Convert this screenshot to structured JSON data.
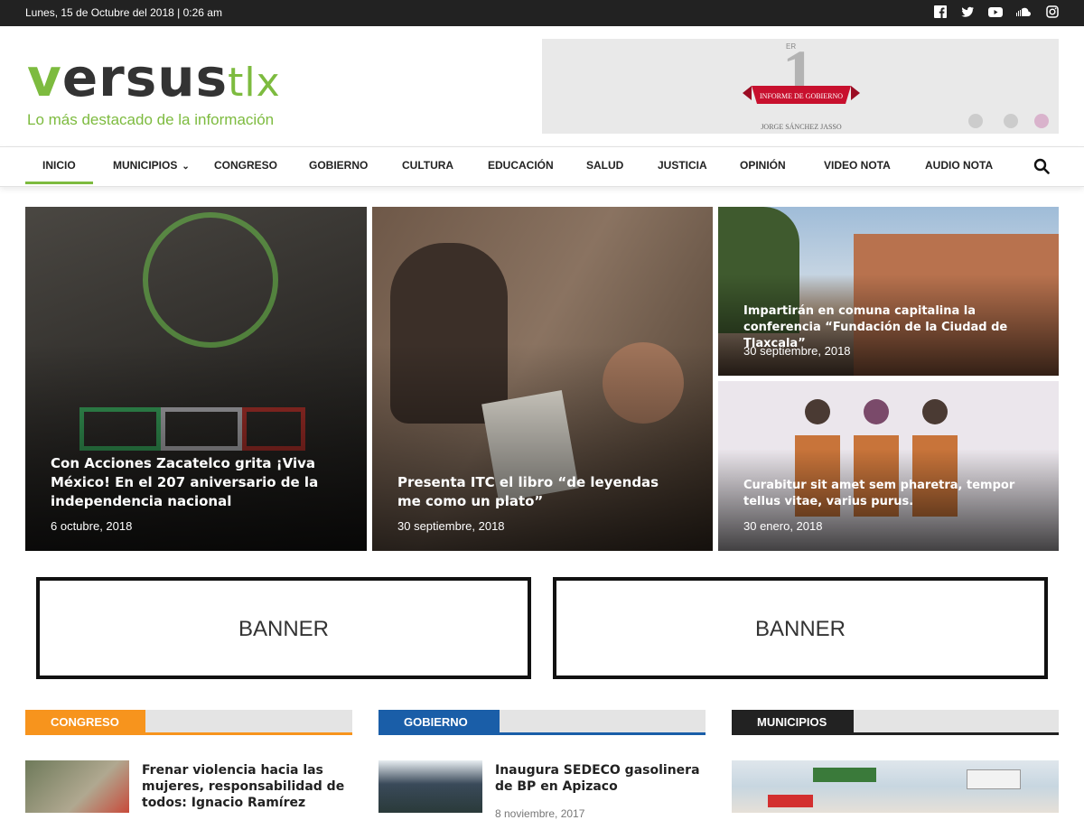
{
  "topbar": {
    "date_text": "Lunes, 15 de Octubre del 2018 | 0:26 am"
  },
  "social": [
    "facebook-icon",
    "twitter-icon",
    "youtube-icon",
    "soundcloud-icon",
    "instagram-icon"
  ],
  "logo": {
    "brand_v": "v",
    "brand_rest": "ersus",
    "brand_tlx": "tlx",
    "tagline": "Lo más destacado de la información"
  },
  "ad": {
    "number": "1",
    "superscript": "ER",
    "ribbon": "INFORME DE GOBIERNO",
    "name": "JORGE SÁNCHEZ JASSO"
  },
  "nav": {
    "items": [
      "INICIO",
      "MUNICIPIOS",
      "CONGRESO",
      "GOBIERNO",
      "CULTURA",
      "EDUCACIÓN",
      "SALUD",
      "JUSTICIA",
      "OPINIÓN",
      "VIDEO NOTA",
      "AUDIO NOTA"
    ],
    "active": "INICIO"
  },
  "featured": [
    {
      "title": "Con Acciones Zacatelco grita ¡Viva México! En el 207 aniversario de la independencia nacional",
      "date": "6 octubre, 2018"
    },
    {
      "title": "Presenta ITC el libro “de leyendas me como un plato”",
      "date": "30 septiembre, 2018"
    },
    {
      "title": "Impartirán en comuna capitalina la conferencia “Fundación de la Ciudad de Tlaxcala”",
      "date": "30 septiembre, 2018"
    },
    {
      "title": "Curabitur sit amet sem pharetra, tempor tellus vitae, varius purus.",
      "date": "30 enero, 2018"
    }
  ],
  "banners": [
    "BANNER",
    "BANNER"
  ],
  "sections": [
    {
      "label": "CONGRESO",
      "color": "#f7941d",
      "article": {
        "title": "Frenar violencia hacia las mujeres, responsabilidad de todos: Ignacio Ramírez",
        "date": ""
      }
    },
    {
      "label": "GOBIERNO",
      "color": "#1a5ea8",
      "article": {
        "title": "Inaugura SEDECO gasolinera de BP en Apizaco",
        "date": "8 noviembre, 2017"
      }
    },
    {
      "label": "MUNICIPIOS",
      "color": "#222222",
      "article": {
        "title": "",
        "date": ""
      }
    }
  ]
}
